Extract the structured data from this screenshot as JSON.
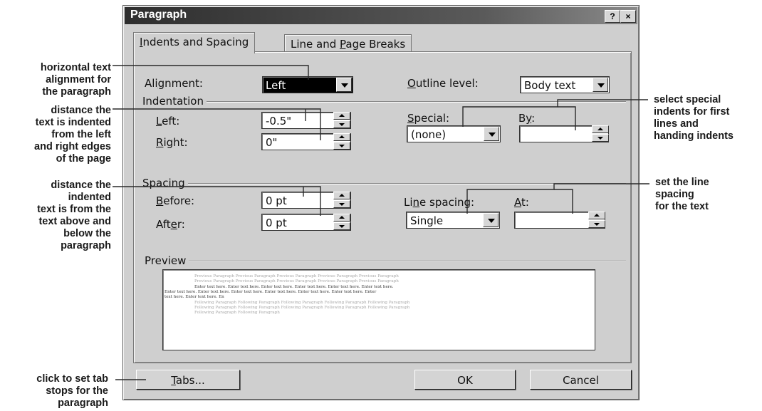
{
  "callouts": {
    "alignment": [
      "horizontal text",
      "alignment for",
      "the paragraph"
    ],
    "indent": [
      "distance the",
      "text is indented",
      "from the left",
      "and right edges",
      "of the page"
    ],
    "spacing": [
      "distance the",
      "indented",
      "text is from the",
      "text above and",
      "below the",
      "paragraph"
    ],
    "tabs": [
      "click to set tab",
      "stops for the",
      "paragraph"
    ],
    "special": [
      "select special",
      "indents for first",
      "lines and",
      "handing indents"
    ],
    "line_spacing": [
      "set the line",
      "spacing",
      "for the text"
    ]
  },
  "dialog": {
    "title": "Paragraph",
    "help_button": "?",
    "close_button": "×",
    "tabs": {
      "indents_pre": "",
      "indents_key": "I",
      "indents_post": "ndents and Spacing",
      "breaks_pre": "Line and ",
      "breaks_key": "P",
      "breaks_post": "age Breaks"
    },
    "alignment": {
      "pre": "Ali",
      "key": "g",
      "post": "nment:",
      "value": "Left"
    },
    "outline_level": {
      "pre": "",
      "key": "O",
      "post": "utline level:",
      "value": "Body text"
    },
    "indentation": {
      "group": "Indentation",
      "left": {
        "pre": "",
        "key": "L",
        "post": "eft:",
        "value": "-0.5\""
      },
      "right": {
        "pre": "",
        "key": "R",
        "post": "ight:",
        "value": "0\""
      }
    },
    "special": {
      "pre": "",
      "key": "S",
      "post": "pecial:",
      "value": "(none)"
    },
    "by": {
      "pre": "B",
      "key": "y",
      "post": ":",
      "value": ""
    },
    "spacing": {
      "group": "Spacing",
      "before": {
        "pre": "",
        "key": "B",
        "post": "efore:",
        "value": "0 pt"
      },
      "after": {
        "pre": "Aft",
        "key": "e",
        "post": "r:",
        "value": "0 pt"
      }
    },
    "line_spacing": {
      "pre": "Li",
      "key": "n",
      "post": "e spacing:",
      "value": "Single"
    },
    "at": {
      "pre": "",
      "key": "A",
      "post": "t:",
      "value": ""
    },
    "preview": {
      "label": "Preview",
      "lines_before": [
        "Previous Paragraph Previous Paragraph Previous Paragraph Previous Paragraph Previous Paragraph",
        "Previous Paragraph Previous Paragraph Previous Paragraph Previous Paragraph Previous Paragraph"
      ],
      "lines_main": [
        "Enter text here.  Enter text here.  Enter text here.  Enter text here.  Enter text here.  Enter text here.",
        "Enter text here.  Enter text here.  Enter text here.  Enter text here.  Enter text here.  Enter text here.  Enter",
        "text here.  Enter text here.  En"
      ],
      "lines_after": [
        "Following Paragraph Following Paragraph Following Paragraph Following Paragraph Following Paragraph",
        "Following Paragraph Following Paragraph Following Paragraph Following Paragraph Following Paragraph",
        "Following Paragraph Following Paragraph"
      ]
    },
    "buttons": {
      "tabs": {
        "pre": "",
        "key": "T",
        "post": "abs..."
      },
      "ok": "OK",
      "cancel": "Cancel"
    }
  }
}
